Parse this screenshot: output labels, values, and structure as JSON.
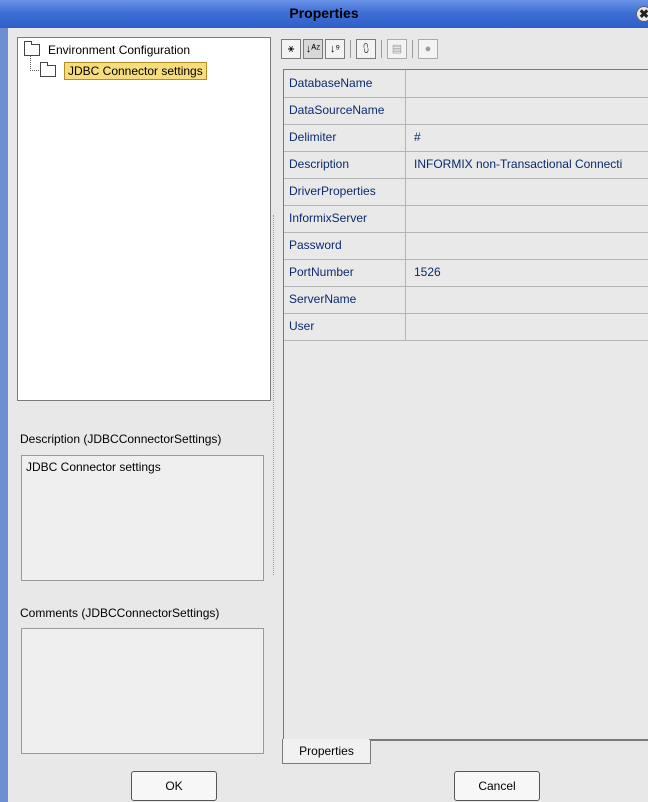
{
  "window": {
    "title": "Properties",
    "close_glyph": "✖"
  },
  "tree": {
    "root_label": "Environment Configuration",
    "child_label": "JDBC Connector settings"
  },
  "description": {
    "title": "Description (JDBCConnectorSettings)",
    "text": "JDBC Connector settings"
  },
  "comments": {
    "title": "Comments (JDBCConnectorSettings)",
    "text": ""
  },
  "toolbar": {
    "buttons": [
      {
        "icon": "categorized-icon",
        "glyph": "⚹"
      },
      {
        "icon": "sort-alphabetical-icon",
        "glyph": "↓ᴬᶻ"
      },
      {
        "icon": "sort-reverse-icon",
        "glyph": "↓⁹"
      },
      {
        "icon": "check-list-icon",
        "glyph": "⩇"
      },
      {
        "icon": "property-page-icon",
        "glyph": "▤"
      },
      {
        "icon": "help-icon",
        "glyph": "●"
      }
    ]
  },
  "properties": [
    {
      "name": "DatabaseName",
      "value": ""
    },
    {
      "name": "DataSourceName",
      "value": ""
    },
    {
      "name": "Delimiter",
      "value": "#"
    },
    {
      "name": "Description",
      "value": "INFORMIX non-Transactional Connecti"
    },
    {
      "name": "DriverProperties",
      "value": ""
    },
    {
      "name": "InformixServer",
      "value": ""
    },
    {
      "name": "Password",
      "value": ""
    },
    {
      "name": "PortNumber",
      "value": "1526"
    },
    {
      "name": "ServerName",
      "value": ""
    },
    {
      "name": "User",
      "value": ""
    }
  ],
  "tab_label": "Properties",
  "buttons": {
    "ok": "OK",
    "cancel": "Cancel"
  }
}
